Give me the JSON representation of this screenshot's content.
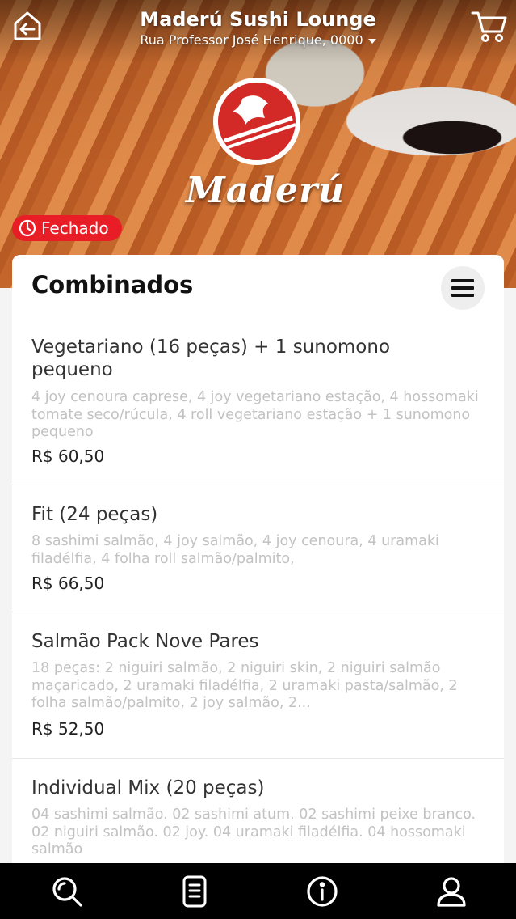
{
  "header": {
    "title": "Maderú Sushi Lounge",
    "address": "Rua Professor José Henrique, 0000",
    "logo_text": "Maderú"
  },
  "status": {
    "label": "Fechado",
    "color": "#e81d25"
  },
  "section": {
    "title": "Combinados",
    "items": [
      {
        "name": "Vegetariano (16 peças) + 1 sunomono pequeno",
        "description": "4 joy cenoura caprese, 4 joy vegetariano estação, 4 hossomaki tomate seco/rúcula, 4 roll vegetariano estação + 1 sunomono pequeno",
        "price": "R$ 60,50"
      },
      {
        "name": "Fit (24 peças)",
        "description": "8 sashimi salmão, 4 joy salmão, 4 joy cenoura, 4 uramaki filadélfia, 4 folha roll salmão/palmito,",
        "price": "R$ 66,50"
      },
      {
        "name": "Salmão Pack Nove Pares",
        "description": "18 peças: 2 niguiri salmão, 2 niguiri skin, 2 niguiri salmão maçaricado, 2 uramaki filadélfia, 2 uramaki pasta/salmão, 2 folha salmão/palmito, 2 joy salmão, 2...",
        "price": "R$ 52,50"
      },
      {
        "name": "Individual Mix (20 peças)",
        "description": "04 sashimi salmão. 02 sashimi atum. 02 sashimi peixe branco. 02 niguiri salmão. 02 joy. 04 uramaki filadélfia. 04 hossomaki salmão",
        "price": ""
      }
    ]
  },
  "nav": {
    "items": [
      {
        "icon": "search-icon"
      },
      {
        "icon": "menu-list-icon"
      },
      {
        "icon": "info-icon"
      },
      {
        "icon": "profile-icon"
      }
    ]
  }
}
